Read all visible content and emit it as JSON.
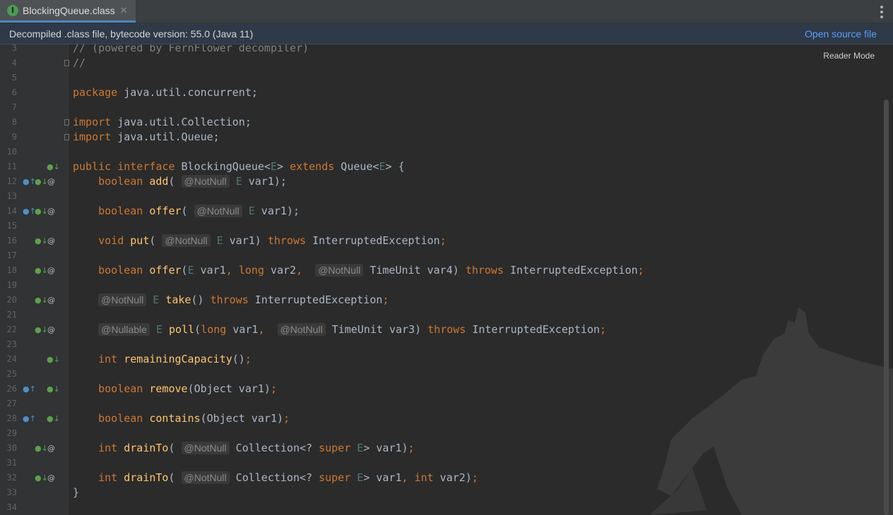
{
  "tab": {
    "icon_letter": "I",
    "label": "BlockingQueue.class",
    "close": "✕"
  },
  "banner": {
    "text": "Decompiled .class file, bytecode version: 55.0 (Java 11)",
    "link": "Open source file"
  },
  "editor": {
    "reader_mode": "Reader Mode",
    "line_numbers": [
      "3",
      "4",
      "5",
      "6",
      "7",
      "8",
      "9",
      "10",
      "11",
      "12",
      "13",
      "14",
      "15",
      "16",
      "17",
      "18",
      "19",
      "20",
      "21",
      "22",
      "23",
      "24",
      "25",
      "26",
      "27",
      "28",
      "29",
      "30",
      "31",
      "32",
      "33",
      "34"
    ],
    "gutter_markers": {
      "11": [
        "implemented"
      ],
      "12": [
        "overrides",
        "implemented",
        "annotated"
      ],
      "14": [
        "overrides",
        "implemented",
        "annotated"
      ],
      "16": [
        "implemented",
        "annotated"
      ],
      "18": [
        "implemented",
        "annotated"
      ],
      "20": [
        "implemented",
        "annotated"
      ],
      "22": [
        "implemented",
        "annotated"
      ],
      "24": [
        "implemented"
      ],
      "26": [
        "overrides",
        "implemented"
      ],
      "28": [
        "overrides",
        "implemented"
      ],
      "30": [
        "implemented",
        "annotated"
      ],
      "32": [
        "implemented",
        "annotated"
      ]
    },
    "colors": {
      "background": "#2b2b2b",
      "keyword": "#cc7832",
      "function": "#ffc66d",
      "type_param": "#507874",
      "comment": "#808080",
      "text": "#a9b7c6",
      "link": "#589df6"
    },
    "code": {
      "l3": "// (powered by FernFlower decompiler)",
      "l4": "//",
      "l6_kw": "package",
      "l6_rest": " java.util.concurrent;",
      "l8_kw": "import",
      "l8_rest": " java.util.Collection;",
      "l9_kw": "import",
      "l9_rest": " java.util.Queue;",
      "l11_kw1": "public interface",
      "l11_a": " BlockingQueue<",
      "l11_tp1": "E",
      "l11_b": "> ",
      "l11_kw2": "extends",
      "l11_c": " Queue<",
      "l11_tp2": "E",
      "l11_d": "> {",
      "notnull": "@NotNull",
      "nullable": "@Nullable",
      "E": "E",
      "boolean": "boolean",
      "void": "void",
      "int": "int",
      "long": "long",
      "throws": "throws",
      "super": "super",
      "add": "add",
      "offer": "offer",
      "put": "put",
      "take": "take",
      "poll": "poll",
      "remainingCapacity": "remainingCapacity",
      "remove": "remove",
      "contains": "contains",
      "drainTo": "drainTo",
      "interrupted": "InterruptedException",
      "l33": "}"
    }
  }
}
